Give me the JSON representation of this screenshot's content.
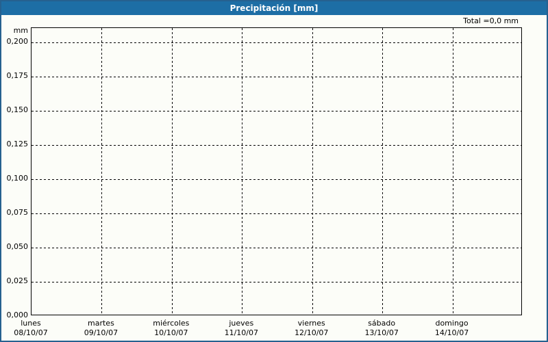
{
  "window": {
    "title": "Precipitación [mm]"
  },
  "header": {
    "total_label": "Total =0,0 mm"
  },
  "chart_data": {
    "type": "bar",
    "title": "Precipitación [mm]",
    "xlabel": "",
    "ylabel": "mm",
    "ylim": [
      0,
      0.21
    ],
    "grid": "dashed",
    "legend": "none",
    "y_ticks": [
      "0,200",
      "0,175",
      "0,150",
      "0,125",
      "0,100",
      "0,075",
      "0,050",
      "0,025",
      "0,000"
    ],
    "y_tick_values": [
      0.2,
      0.175,
      0.15,
      0.125,
      0.1,
      0.075,
      0.05,
      0.025,
      0.0
    ],
    "categories": [
      {
        "day": "lunes",
        "date": "08/10/07"
      },
      {
        "day": "martes",
        "date": "09/10/07"
      },
      {
        "day": "miércoles",
        "date": "10/10/07"
      },
      {
        "day": "jueves",
        "date": "11/10/07"
      },
      {
        "day": "viernes",
        "date": "12/10/07"
      },
      {
        "day": "sábado",
        "date": "13/10/07"
      },
      {
        "day": "domingo",
        "date": "14/10/07"
      }
    ],
    "series": [
      {
        "name": "Precipitación",
        "unit": "mm",
        "values": [
          0,
          0,
          0,
          0,
          0,
          0,
          0
        ]
      }
    ],
    "total": "0,0",
    "total_unit": "mm"
  },
  "colors": {
    "titlebar": "#1D6EA5",
    "frame_border": "#26618F",
    "background": "#FCFDF8",
    "grid": "#000000",
    "title_text": "#FFFFFF"
  }
}
